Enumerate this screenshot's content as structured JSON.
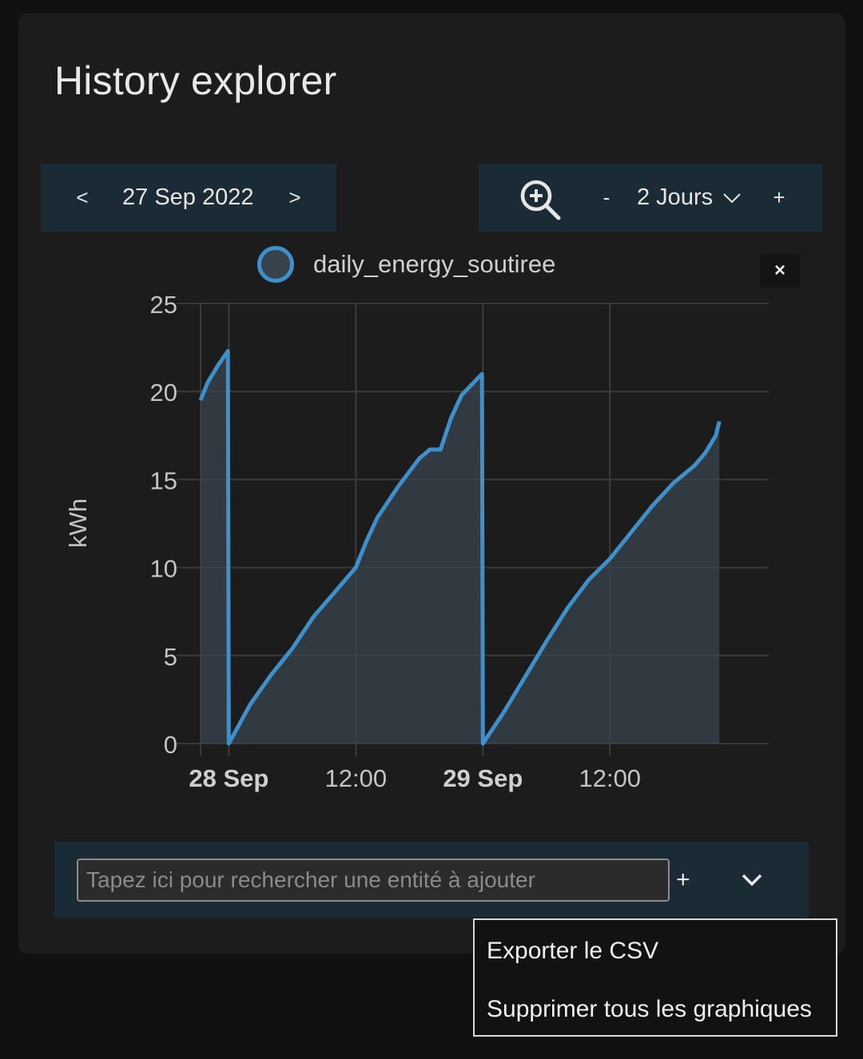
{
  "page": {
    "title": "History explorer"
  },
  "date_nav": {
    "prev_label": "<",
    "date": "27 Sep 2022",
    "next_label": ">"
  },
  "zoom": {
    "icon": "zoom-in-icon",
    "minus_label": "-",
    "range_label": "2 Jours",
    "plus_label": "+"
  },
  "legend": {
    "label": "daily_energy_soutiree",
    "close_label": "×"
  },
  "search": {
    "placeholder": "Tapez ici pour rechercher une entité à ajouter",
    "add_label": "+"
  },
  "menu": {
    "items": [
      "Exporter le CSV",
      "Supprimer tous les graphiques"
    ]
  },
  "colors": {
    "accent": "#3f8fca",
    "panel": "#1b2b36",
    "card": "#1c1c1c",
    "background": "#111111"
  },
  "chart_data": {
    "type": "area",
    "ylabel": "kWh",
    "ylim": [
      0,
      25
    ],
    "yticks": [
      0,
      5,
      10,
      15,
      20,
      25
    ],
    "xlim": [
      "2022-09-27T21:20",
      "2022-09-30T03:00"
    ],
    "xticks": [
      {
        "t": "2022-09-28T00:00",
        "label": "28 Sep",
        "bold": true
      },
      {
        "t": "2022-09-28T12:00",
        "label": "12:00",
        "bold": false
      },
      {
        "t": "2022-09-29T00:00",
        "label": "29 Sep",
        "bold": true
      },
      {
        "t": "2022-09-29T12:00",
        "label": "12:00",
        "bold": false
      }
    ],
    "grid": true,
    "series": [
      {
        "name": "daily_energy_soutiree",
        "points": [
          [
            "2022-09-27T21:20",
            19.5
          ],
          [
            "2022-09-27T22:00",
            20.5
          ],
          [
            "2022-09-27T23:00",
            21.5
          ],
          [
            "2022-09-27T23:55",
            22.3
          ],
          [
            "2022-09-28T00:00",
            0.0
          ],
          [
            "2022-09-28T01:00",
            1.1
          ],
          [
            "2022-09-28T02:00",
            2.2
          ],
          [
            "2022-09-28T04:00",
            3.9
          ],
          [
            "2022-09-28T06:00",
            5.4
          ],
          [
            "2022-09-28T08:00",
            7.2
          ],
          [
            "2022-09-28T10:00",
            8.6
          ],
          [
            "2022-09-28T12:00",
            10.0
          ],
          [
            "2022-09-28T13:00",
            11.5
          ],
          [
            "2022-09-28T14:00",
            12.8
          ],
          [
            "2022-09-28T16:00",
            14.6
          ],
          [
            "2022-09-28T18:00",
            16.2
          ],
          [
            "2022-09-28T19:00",
            16.7
          ],
          [
            "2022-09-28T20:00",
            16.7
          ],
          [
            "2022-09-28T21:00",
            18.5
          ],
          [
            "2022-09-28T22:00",
            19.8
          ],
          [
            "2022-09-28T23:55",
            21.0
          ],
          [
            "2022-09-29T00:00",
            0.0
          ],
          [
            "2022-09-29T01:00",
            0.9
          ],
          [
            "2022-09-29T02:00",
            1.8
          ],
          [
            "2022-09-29T04:00",
            3.8
          ],
          [
            "2022-09-29T06:00",
            5.8
          ],
          [
            "2022-09-29T08:00",
            7.7
          ],
          [
            "2022-09-29T10:00",
            9.3
          ],
          [
            "2022-09-29T12:00",
            10.5
          ],
          [
            "2022-09-29T14:00",
            12.0
          ],
          [
            "2022-09-29T16:00",
            13.5
          ],
          [
            "2022-09-29T18:00",
            14.8
          ],
          [
            "2022-09-29T20:00",
            15.8
          ],
          [
            "2022-09-29T21:00",
            16.5
          ],
          [
            "2022-09-29T22:00",
            17.5
          ],
          [
            "2022-09-29T22:20",
            18.3
          ]
        ]
      }
    ]
  }
}
